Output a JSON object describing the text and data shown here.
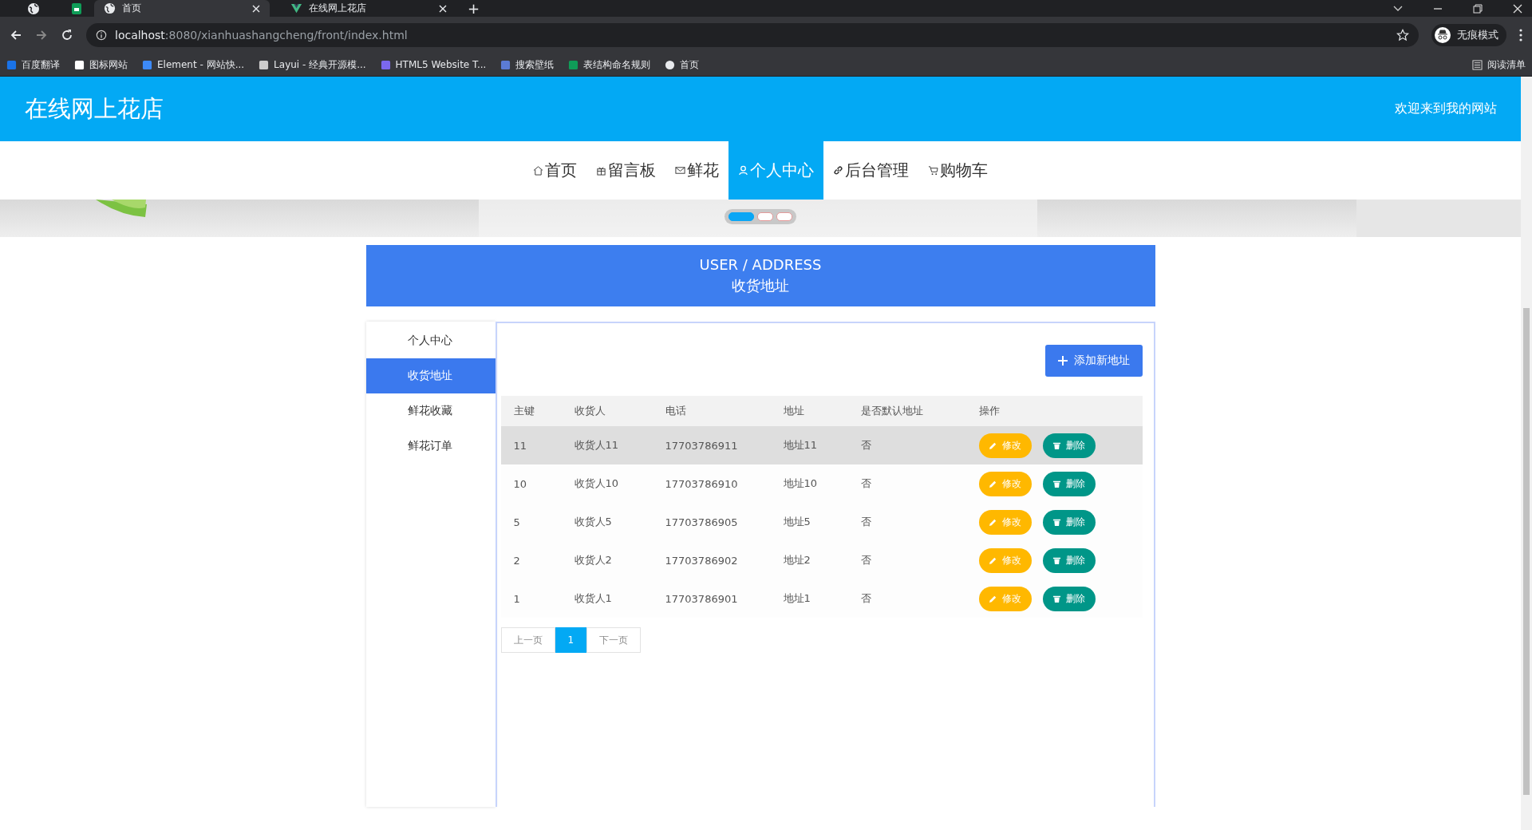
{
  "browser": {
    "tabs": [
      {
        "title": "首页",
        "selected": true
      },
      {
        "title": "在线网上花店",
        "selected": false
      }
    ],
    "new_tab": "+",
    "url_host": "localhost",
    "url_rest": ":8080/xianhuashangcheng/front/index.html",
    "profile": "无痕模式",
    "bookmarks": [
      "百度翻译",
      "图标网站",
      "Element - 网站快...",
      "Layui - 经典开源模...",
      "HTML5 Website T...",
      "搜索壁纸",
      "表结构命名规则",
      "首页"
    ],
    "reading_list": "阅读清单"
  },
  "header": {
    "title": "在线网上花店",
    "welcome": "欢迎来到我的网站"
  },
  "nav": [
    {
      "label": "首页",
      "selected": false
    },
    {
      "label": "留言板",
      "selected": false
    },
    {
      "label": "鲜花",
      "selected": false
    },
    {
      "label": "个人中心",
      "selected": true
    },
    {
      "label": "后台管理",
      "selected": false
    },
    {
      "label": "购物车",
      "selected": false
    }
  ],
  "carousel_dots": [
    {
      "selected": true
    },
    {
      "selected": false
    },
    {
      "selected": false
    }
  ],
  "banner": {
    "title_en": "USER / ADDRESS",
    "title": "收货地址"
  },
  "sidebar": [
    {
      "label": "个人中心",
      "selected": false
    },
    {
      "label": "收货地址",
      "selected": true
    },
    {
      "label": "鲜花收藏",
      "selected": false
    },
    {
      "label": "鲜花订单",
      "selected": false
    }
  ],
  "add_button": "添加新地址",
  "table": {
    "columns": [
      "主键",
      "收货人",
      "电话",
      "地址",
      "是否默认地址",
      "操作"
    ],
    "rows": [
      {
        "id": "11",
        "name": "收货人11",
        "phone": "17703786911",
        "address": "地址11",
        "default": "否",
        "edit": "修改",
        "delete": "删除",
        "highlighted": true
      },
      {
        "id": "10",
        "name": "收货人10",
        "phone": "17703786910",
        "address": "地址10",
        "default": "否",
        "edit": "修改",
        "delete": "删除",
        "highlighted": false
      },
      {
        "id": "5",
        "name": "收货人5",
        "phone": "17703786905",
        "address": "地址5",
        "default": "否",
        "edit": "修改",
        "delete": "删除",
        "highlighted": false
      },
      {
        "id": "2",
        "name": "收货人2",
        "phone": "17703786902",
        "address": "地址2",
        "default": "否",
        "edit": "修改",
        "delete": "删除",
        "highlighted": false
      },
      {
        "id": "1",
        "name": "收货人1",
        "phone": "17703786901",
        "address": "地址1",
        "default": "否",
        "edit": "修改",
        "delete": "删除",
        "highlighted": false
      }
    ]
  },
  "pagination": {
    "prev": "上一页",
    "pages": [
      {
        "label": "1",
        "selected": true
      }
    ],
    "next": "下一页"
  }
}
